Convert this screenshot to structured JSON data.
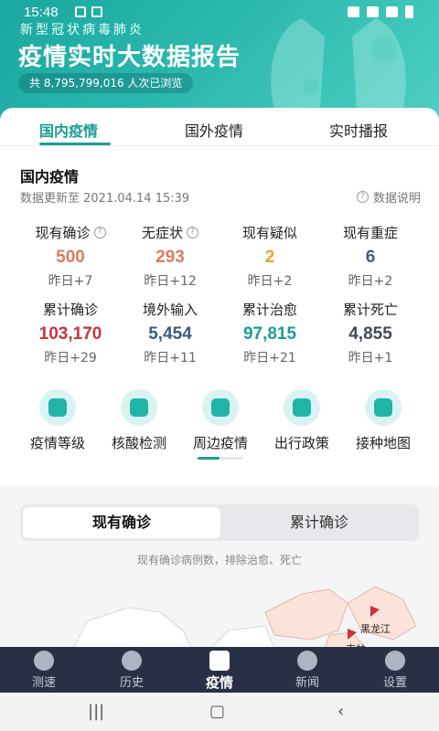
{
  "status_bar": {
    "time": "15:48"
  },
  "header": {
    "virus_name": "新型冠状病毒肺炎",
    "title": "疫情实时大数据报告",
    "views": "共 8,795,799,016 人次已浏览"
  },
  "tabs": [
    "国内疫情",
    "国外疫情",
    "实时播报"
  ],
  "domestic": {
    "title": "国内疫情",
    "update_time": "数据更新至 2021.04.14 15:39",
    "data_note": "数据说明",
    "stats": [
      {
        "label": "现有确诊",
        "value": "500",
        "prefix": "昨日",
        "change": "+7",
        "color": "#e07a5f",
        "help": true
      },
      {
        "label": "无症状",
        "value": "293",
        "prefix": "昨日",
        "change": "+12",
        "color": "#e07a5f",
        "help": true
      },
      {
        "label": "现有疑似",
        "value": "2",
        "prefix": "昨日",
        "change": "+2",
        "color": "#e7a63a",
        "help": false
      },
      {
        "label": "现有重症",
        "value": "6",
        "prefix": "昨日",
        "change": "+2",
        "color": "#4a5a78",
        "help": false
      },
      {
        "label": "累计确诊",
        "value": "103,170",
        "prefix": "昨日",
        "change": "+29",
        "color": "#c9343b",
        "help": false
      },
      {
        "label": "境外输入",
        "value": "5,454",
        "prefix": "昨日",
        "change": "+11",
        "color": "#3c5a85",
        "help": false
      },
      {
        "label": "累计治愈",
        "value": "97,815",
        "prefix": "昨日",
        "change": "+21",
        "color": "#1b9e94",
        "help": false
      },
      {
        "label": "累计死亡",
        "value": "4,855",
        "prefix": "昨日",
        "change": "+1",
        "color": "#444a55",
        "help": false
      }
    ]
  },
  "quick_links": [
    {
      "label": "疫情等级",
      "icon": "alert-level-icon"
    },
    {
      "label": "核酸检测",
      "icon": "test-tube-icon"
    },
    {
      "label": "周边疫情",
      "icon": "nearby-buildings-icon"
    },
    {
      "label": "出行政策",
      "icon": "car-icon"
    },
    {
      "label": "接种地图",
      "icon": "vaccine-plus-icon"
    }
  ],
  "map_section": {
    "toggle": [
      "现有确诊",
      "累计确诊"
    ],
    "caption": "现有确诊病例数，排除治愈、死亡",
    "labels": [
      "黑龙江",
      "吉林"
    ]
  },
  "bottom_nav": [
    {
      "label": "测速",
      "icon": "speed-gauge-icon"
    },
    {
      "label": "历史",
      "icon": "history-pin-icon"
    },
    {
      "label": "疫情",
      "icon": "medical-cross-icon"
    },
    {
      "label": "新闻",
      "icon": "newspaper-icon"
    },
    {
      "label": "设置",
      "icon": "gear-icon"
    }
  ],
  "colors": {
    "accent": "#1b9e94",
    "header": "#2bb8ae",
    "nav_bg": "#283046"
  }
}
